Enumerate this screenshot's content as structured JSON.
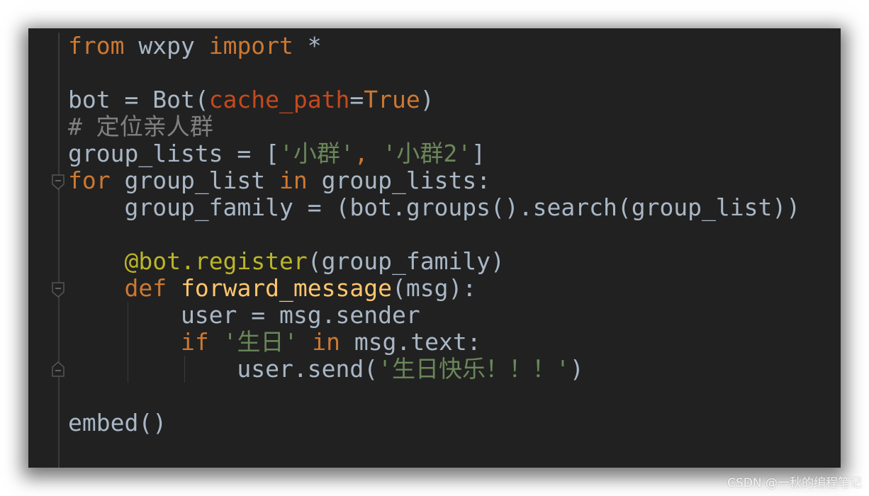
{
  "editor": {
    "colors": {
      "background": "#212121",
      "keyword": "#cc7832",
      "text": "#a9b7c6",
      "param": "#c4491f",
      "string": "#6a8759",
      "comment": "#808080",
      "decorator": "#bbb529",
      "function": "#ffc66d"
    },
    "lines": [
      [
        [
          "kw",
          "from"
        ],
        [
          "txt",
          " wxpy "
        ],
        [
          "kw",
          "import"
        ],
        [
          "txt",
          " *"
        ]
      ],
      [],
      [
        [
          "txt",
          "bot = Bot("
        ],
        [
          "param",
          "cache_path"
        ],
        [
          "txt",
          "="
        ],
        [
          "kw",
          "True"
        ],
        [
          "txt",
          ")"
        ]
      ],
      [
        [
          "cmt",
          "# 定位亲人群"
        ]
      ],
      [
        [
          "txt",
          "group_lists = ["
        ],
        [
          "str",
          "'小群'"
        ],
        [
          "kw",
          ", "
        ],
        [
          "str",
          "'小群2'"
        ],
        [
          "txt",
          "]"
        ]
      ],
      [
        [
          "kw",
          "for"
        ],
        [
          "txt",
          " group_list "
        ],
        [
          "kw",
          "in"
        ],
        [
          "txt",
          " group_lists:"
        ]
      ],
      [
        [
          "txt",
          "    group_family = (bot.groups().search(group_list))"
        ]
      ],
      [],
      [
        [
          "txt",
          "    "
        ],
        [
          "deco",
          "@bot.register"
        ],
        [
          "txt",
          "(group_family)"
        ]
      ],
      [
        [
          "txt",
          "    "
        ],
        [
          "kw",
          "def"
        ],
        [
          "txt",
          " "
        ],
        [
          "fn",
          "forward_message"
        ],
        [
          "txt",
          "(msg):"
        ]
      ],
      [
        [
          "txt",
          "        user = msg.sender"
        ]
      ],
      [
        [
          "txt",
          "        "
        ],
        [
          "kw",
          "if"
        ],
        [
          "txt",
          " "
        ],
        [
          "str",
          "'生日'"
        ],
        [
          "txt",
          " "
        ],
        [
          "kw",
          "in"
        ],
        [
          "txt",
          " msg.text:"
        ]
      ],
      [
        [
          "txt",
          "            user.send("
        ],
        [
          "str",
          "'生日快乐！！！'"
        ],
        [
          "txt",
          ")"
        ]
      ],
      [],
      [
        [
          "txt",
          "embed()"
        ]
      ]
    ]
  },
  "watermark": "CSDN @一秋的编程笔记"
}
